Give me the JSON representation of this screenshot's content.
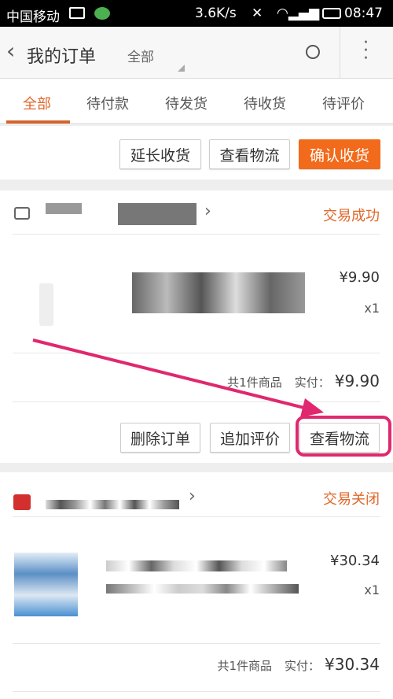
{
  "status_bar": {
    "carrier": "中国移动",
    "speed": "3.6K/s",
    "time": "08:47"
  },
  "header": {
    "title": "我的订单",
    "filter": "全部"
  },
  "tabs": [
    {
      "label": "全部",
      "active": true
    },
    {
      "label": "待付款"
    },
    {
      "label": "待发货"
    },
    {
      "label": "待收货"
    },
    {
      "label": "待评价"
    }
  ],
  "top_actions": [
    "延长收货",
    "查看物流",
    "确认收货"
  ],
  "orders": [
    {
      "status": "交易成功",
      "price": "¥9.90",
      "qty": "x1",
      "count_text": "共1件商品",
      "paid_label": "实付：",
      "paid": "¥9.90",
      "actions": [
        "删除订单",
        "追加评价",
        "查看物流"
      ]
    },
    {
      "status": "交易关闭",
      "price": "¥30.34",
      "qty": "x1",
      "count_text": "共1件商品",
      "paid_label": "实付：",
      "paid": "¥30.34"
    }
  ],
  "annotation_color": "#e0286e",
  "accent": "#f26a1b"
}
